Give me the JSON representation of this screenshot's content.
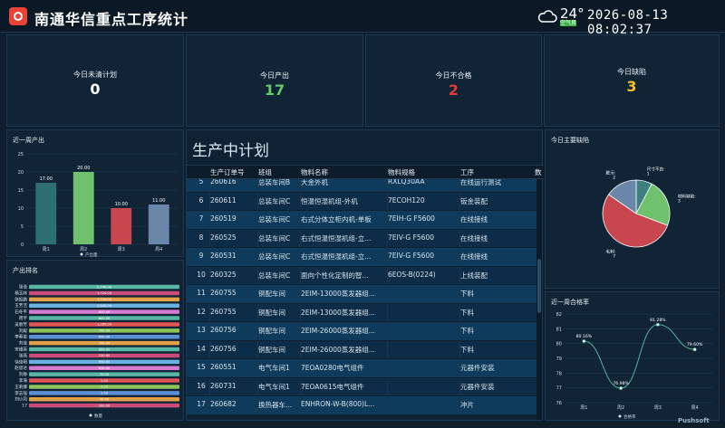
{
  "header": {
    "title": "南通华信重点工序统计",
    "temperature": "24°",
    "air_quality": "空气良",
    "datetime": "2026-08-13 08:02:37"
  },
  "kpis": [
    {
      "label": "今日未清计划",
      "value": "0",
      "color": "#ffffff"
    },
    {
      "label": "今日产出",
      "value": "17",
      "color": "#66c96a"
    },
    {
      "label": "今日不合格",
      "value": "2",
      "color": "#e23b3b"
    },
    {
      "label": "今日缺陷",
      "value": "3",
      "color": "#f5c02c"
    }
  ],
  "weekly_output": {
    "title": "近一周产出",
    "chart_data": {
      "type": "bar",
      "categories": [
        "周1",
        "周2",
        "周3",
        "周4"
      ],
      "values": [
        17,
        20,
        10,
        11
      ],
      "value_labels": [
        "17.00",
        "20.00",
        "10.00",
        "11.00"
      ],
      "colors": [
        "#2d6e70",
        "#6fc16e",
        "#c8474f",
        "#6a86a8"
      ],
      "ylim": [
        0,
        25
      ],
      "yticks": [
        0,
        5,
        10,
        15,
        20,
        25
      ],
      "legend": "产出量"
    }
  },
  "output_ranking": {
    "title": "产出排名",
    "chart_data": {
      "type": "bar",
      "orientation": "horizontal",
      "categories": [
        "张浩",
        "杨玉林",
        "张振鹏",
        "王芳洁",
        "石冬平",
        "周宇",
        "吴春芳",
        "刘毅",
        "李春苗",
        "刘佳",
        "宋维英",
        "张燕",
        "徐佳明",
        "赵思达",
        "刘静",
        "李海",
        "王莉娜",
        "李志强",
        "刘小凤",
        "17"
      ],
      "value_labels": [
        "2,745.00",
        "1,720.00",
        "1,710.00",
        "1,545.00",
        "600.00",
        "600.00",
        "1,285.00",
        "700.00",
        "650.00",
        "700.00",
        "850.00",
        "230.00",
        "900.00",
        "810.00",
        "70.00",
        "1.00",
        "1.00",
        "1.00",
        "70.00",
        "200.00"
      ],
      "colors": [
        "#58b7a6",
        "#c94d78",
        "#e0a04a",
        "#6ab0e0",
        "#d57ad0",
        "#58b7a6",
        "#e05555",
        "#8cc35a",
        "#5c8fd6",
        "#e0a04a",
        "#58b7a6",
        "#c94d78",
        "#6ab0e0",
        "#d57ad0",
        "#58b7a6",
        "#e05555",
        "#8cc35a",
        "#5c8fd6",
        "#e0a04a",
        "#c94d78"
      ],
      "legend": "数量"
    }
  },
  "plan": {
    "title": "生产中计划",
    "columns": [
      "",
      "生产订单号",
      "班组",
      "物料名称",
      "物料规格",
      "工序",
      "数"
    ],
    "rows": [
      [
        "5",
        "260616",
        "总装车间B",
        "大金外机",
        "RXLQ30AA",
        "在线运行测试"
      ],
      [
        "6",
        "260611",
        "总装车间C",
        "恒温恒湿机组-外机",
        "7ECOH120",
        "钣金装配"
      ],
      [
        "7",
        "260519",
        "总装车间C",
        "右式分体立柜内机-单板",
        "7EIH-G F5600",
        "在线接线"
      ],
      [
        "8",
        "260525",
        "总装车间C",
        "右式恒温恒湿机组-立...",
        "7EIV-G F5600",
        "在线接线"
      ],
      [
        "9",
        "260531",
        "总装车间C",
        "右式恒温恒湿机组-立...",
        "7EIV-G F5600",
        "在线接线"
      ],
      [
        "10",
        "260325",
        "总装车间C",
        "面向个性化定制的智...",
        "6EOS-B(0224)",
        "上线装配"
      ],
      [
        "11",
        "260755",
        "铜配车间",
        "2EIM-13000蒸发器组...",
        "",
        "下料"
      ],
      [
        "12",
        "260755",
        "铜配车间",
        "2EIM-13000蒸发器组...",
        "",
        "下料"
      ],
      [
        "13",
        "260756",
        "铜配车间",
        "2EIM-26000蒸发器组...",
        "",
        "下料"
      ],
      [
        "14",
        "260756",
        "铜配车间",
        "2EIM-26000蒸发器组...",
        "",
        "下料"
      ],
      [
        "15",
        "260551",
        "电气车间1",
        "7EOA0280电气组件",
        "",
        "元器件安装"
      ],
      [
        "16",
        "260731",
        "电气车间1",
        "7EOA0615电气组件",
        "",
        "元器件安装"
      ],
      [
        "17",
        "260682",
        "换热器车...",
        "ENHRON-W-B(800)L...",
        "",
        "冲片"
      ]
    ]
  },
  "defects": {
    "title": "今日主要缺陷",
    "chart_data": {
      "type": "pie",
      "slices": [
        {
          "label": "尺寸不良",
          "value": 1,
          "color": "#3d7e7f",
          "text": "尺寸不良:\n1"
        },
        {
          "label": "材料缺陷",
          "value": 3,
          "color": "#6fc16e",
          "text": "材料缺陷:\n3"
        },
        {
          "label": "毛刺",
          "value": 7,
          "color": "#c8474f",
          "text": "毛刺:\n7"
        },
        {
          "label": "脏污",
          "value": 2,
          "color": "#6a86a8",
          "text": "脏污:\n2"
        }
      ]
    }
  },
  "pass_rate": {
    "title": "近一周合格率",
    "chart_data": {
      "type": "line",
      "categories": [
        "周1",
        "周2",
        "周3",
        "周4"
      ],
      "values": [
        80.16,
        76.98,
        81.28,
        79.6
      ],
      "value_labels": [
        "80.16%",
        "76.98%",
        "81.28%",
        "79.60%"
      ],
      "ylim": [
        76,
        82
      ],
      "yticks": [
        76,
        77,
        78,
        79,
        80,
        81,
        82
      ],
      "legend": "合格率",
      "color": "#4fb3a0"
    }
  },
  "watermark": "Pushsoft"
}
